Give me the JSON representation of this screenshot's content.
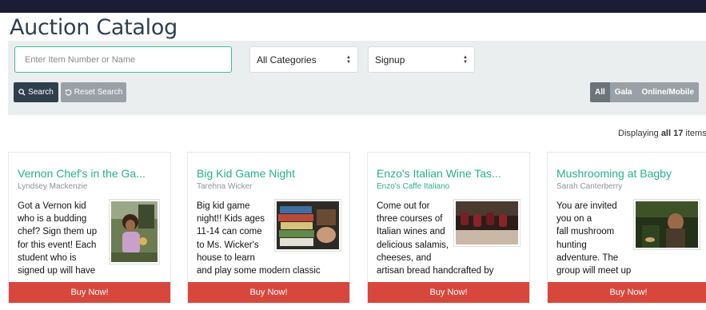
{
  "page": {
    "title": "Auction Catalog"
  },
  "search": {
    "placeholder": "Enter Item Number or Name",
    "category_selected": "All Categories",
    "signup_selected": "Signup",
    "search_label": "Search",
    "reset_label": "Reset Search"
  },
  "filters": {
    "all": "All",
    "gala": "Gala",
    "online": "Online/Mobile",
    "active": "All"
  },
  "results": {
    "prefix": "Displaying",
    "all_word": "all",
    "count": "17",
    "suffix": "items"
  },
  "cards": [
    {
      "title": "Vernon Chef's in the Ga...",
      "subtitle": "Lyndsey Mackenzie",
      "lines": [
        "Got a Vernon kid",
        "who is a budding",
        "chef? Sign them up",
        "for this event! Each",
        "student who is",
        "signed up will have"
      ],
      "buy_label": "Buy Now!",
      "image_icon": "child-garden-photo"
    },
    {
      "title": "Big Kid Game Night",
      "subtitle": "Tarehna Wicker",
      "lines": [
        "Big kid game",
        "night!!  Kids ages",
        "11-14 can come",
        "to Ms. Wicker's",
        "house to learn",
        "and play some modern classic"
      ],
      "buy_label": "Buy Now!",
      "image_icon": "board-games-photo"
    },
    {
      "title": "Enzo's Italian Wine Tas...",
      "subtitle": "Enzo's Caffe Italiano",
      "lines": [
        "Come out for",
        "three courses of",
        "Italian wines and",
        "delicious salamis,",
        "cheeses, and",
        "artisan bread handcrafted by"
      ],
      "buy_label": "Buy Now!",
      "image_icon": "wine-glasses-photo"
    },
    {
      "title": "Mushrooming at Bagby",
      "subtitle": "Sarah Canterberry",
      "lines": [
        "You are invited",
        "you on a",
        "fall mushroom",
        "hunting",
        "adventure.  The",
        "group will meet up at"
      ],
      "buy_label": "Buy Now!",
      "image_icon": "forest-mushroom-photo"
    }
  ],
  "colors": {
    "accent": "#26b08a",
    "buy": "#d8473c",
    "dark": "#2f3f4c",
    "topbar": "#1c1c34"
  }
}
